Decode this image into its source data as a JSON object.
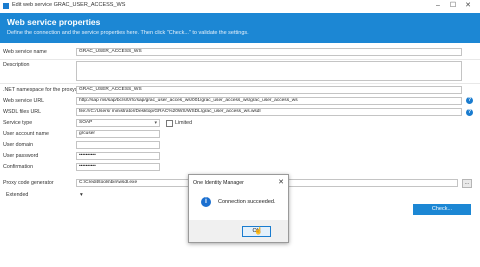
{
  "window": {
    "title": "Edit web service GRAC_USER_ACCESS_WS",
    "minimize_icon": "minimize-icon",
    "maximize_icon": "maximize-icon",
    "close_icon": "close-icon"
  },
  "header": {
    "title": "Web service properties",
    "subtitle": "Define the connection and the service properties here. Then click \"Check...\" to validate the settings.",
    "color": "#1c87d4"
  },
  "form": {
    "web_service_name": {
      "label": "Web service name",
      "value": ""
    },
    "description": {
      "label": "Description",
      "value": ""
    },
    "net_namespace": {
      "label": ".NET namespace for the proxys...",
      "value": "GRAC_USER_ACCESS_WS"
    },
    "web_service_url": {
      "label": "Web service URL",
      "value": "http://sap              ms/sap/bc/srt/rfc/sap/grac_user_acces_ws/001/grac_user_access_ws/grac_user_access_ws"
    },
    "wsdl_url": {
      "label": "WSDL files URL",
      "value": "file:///C:/Users/             ministrator/Desktop/GRAC%20WS/WSDL/grac_user_access_ws.wsdl"
    },
    "service_type": {
      "label": "Service type",
      "value": "SOAP",
      "limited_label": "Limited"
    },
    "user_account_name": {
      "label": "User account name",
      "value": "grcuser"
    },
    "user_domain": {
      "label": "User domain",
      "value": ""
    },
    "user_password": {
      "label": "User password",
      "value": "••••••••••"
    },
    "confirmation": {
      "label": "Confirmation",
      "value": "••••••••••"
    },
    "proxy_code_generator": {
      "label": "Proxy code generator",
      "value": "C:\\Credit\\tools\\bin\\wsdl.exe",
      "browse_label": "..."
    },
    "extended": {
      "label": "Extended"
    },
    "check_button": "Check..."
  },
  "first_value": "GRAC_USER_ACCESS_WS",
  "dialog": {
    "title": "One Identity Manager",
    "close": "✕",
    "message": "Connection succeeded.",
    "icon": "info-icon",
    "ok_label": "OK"
  }
}
